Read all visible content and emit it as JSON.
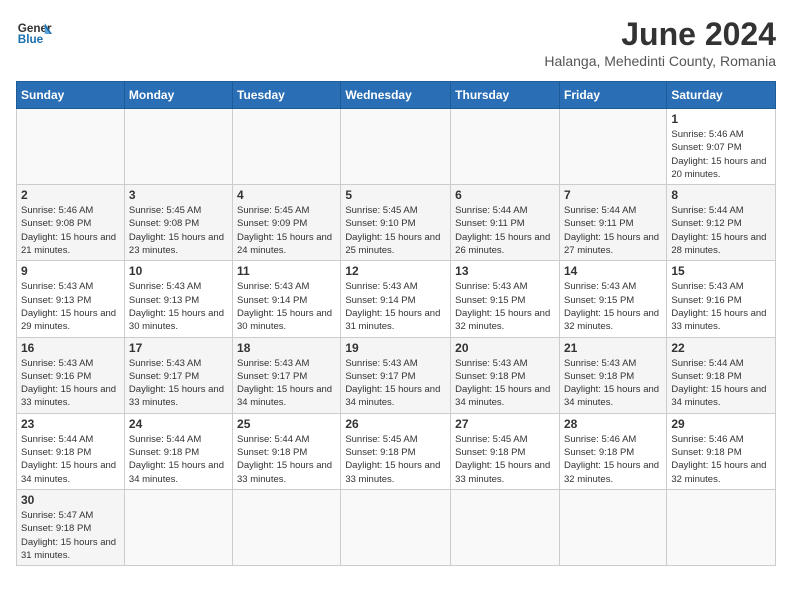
{
  "header": {
    "logo_general": "General",
    "logo_blue": "Blue",
    "month_title": "June 2024",
    "subtitle": "Halanga, Mehedinti County, Romania"
  },
  "weekdays": [
    "Sunday",
    "Monday",
    "Tuesday",
    "Wednesday",
    "Thursday",
    "Friday",
    "Saturday"
  ],
  "weeks": [
    [
      {
        "day": "",
        "info": ""
      },
      {
        "day": "",
        "info": ""
      },
      {
        "day": "",
        "info": ""
      },
      {
        "day": "",
        "info": ""
      },
      {
        "day": "",
        "info": ""
      },
      {
        "day": "",
        "info": ""
      },
      {
        "day": "1",
        "info": "Sunrise: 5:46 AM\nSunset: 9:07 PM\nDaylight: 15 hours\nand 20 minutes."
      }
    ],
    [
      {
        "day": "2",
        "info": "Sunrise: 5:46 AM\nSunset: 9:08 PM\nDaylight: 15 hours\nand 21 minutes."
      },
      {
        "day": "3",
        "info": "Sunrise: 5:45 AM\nSunset: 9:08 PM\nDaylight: 15 hours\nand 23 minutes."
      },
      {
        "day": "4",
        "info": "Sunrise: 5:45 AM\nSunset: 9:09 PM\nDaylight: 15 hours\nand 24 minutes."
      },
      {
        "day": "5",
        "info": "Sunrise: 5:45 AM\nSunset: 9:10 PM\nDaylight: 15 hours\nand 25 minutes."
      },
      {
        "day": "6",
        "info": "Sunrise: 5:44 AM\nSunset: 9:11 PM\nDaylight: 15 hours\nand 26 minutes."
      },
      {
        "day": "7",
        "info": "Sunrise: 5:44 AM\nSunset: 9:11 PM\nDaylight: 15 hours\nand 27 minutes."
      },
      {
        "day": "8",
        "info": "Sunrise: 5:44 AM\nSunset: 9:12 PM\nDaylight: 15 hours\nand 28 minutes."
      }
    ],
    [
      {
        "day": "9",
        "info": "Sunrise: 5:43 AM\nSunset: 9:13 PM\nDaylight: 15 hours\nand 29 minutes."
      },
      {
        "day": "10",
        "info": "Sunrise: 5:43 AM\nSunset: 9:13 PM\nDaylight: 15 hours\nand 30 minutes."
      },
      {
        "day": "11",
        "info": "Sunrise: 5:43 AM\nSunset: 9:14 PM\nDaylight: 15 hours\nand 30 minutes."
      },
      {
        "day": "12",
        "info": "Sunrise: 5:43 AM\nSunset: 9:14 PM\nDaylight: 15 hours\nand 31 minutes."
      },
      {
        "day": "13",
        "info": "Sunrise: 5:43 AM\nSunset: 9:15 PM\nDaylight: 15 hours\nand 32 minutes."
      },
      {
        "day": "14",
        "info": "Sunrise: 5:43 AM\nSunset: 9:15 PM\nDaylight: 15 hours\nand 32 minutes."
      },
      {
        "day": "15",
        "info": "Sunrise: 5:43 AM\nSunset: 9:16 PM\nDaylight: 15 hours\nand 33 minutes."
      }
    ],
    [
      {
        "day": "16",
        "info": "Sunrise: 5:43 AM\nSunset: 9:16 PM\nDaylight: 15 hours\nand 33 minutes."
      },
      {
        "day": "17",
        "info": "Sunrise: 5:43 AM\nSunset: 9:17 PM\nDaylight: 15 hours\nand 33 minutes."
      },
      {
        "day": "18",
        "info": "Sunrise: 5:43 AM\nSunset: 9:17 PM\nDaylight: 15 hours\nand 34 minutes."
      },
      {
        "day": "19",
        "info": "Sunrise: 5:43 AM\nSunset: 9:17 PM\nDaylight: 15 hours\nand 34 minutes."
      },
      {
        "day": "20",
        "info": "Sunrise: 5:43 AM\nSunset: 9:18 PM\nDaylight: 15 hours\nand 34 minutes."
      },
      {
        "day": "21",
        "info": "Sunrise: 5:43 AM\nSunset: 9:18 PM\nDaylight: 15 hours\nand 34 minutes."
      },
      {
        "day": "22",
        "info": "Sunrise: 5:44 AM\nSunset: 9:18 PM\nDaylight: 15 hours\nand 34 minutes."
      }
    ],
    [
      {
        "day": "23",
        "info": "Sunrise: 5:44 AM\nSunset: 9:18 PM\nDaylight: 15 hours\nand 34 minutes."
      },
      {
        "day": "24",
        "info": "Sunrise: 5:44 AM\nSunset: 9:18 PM\nDaylight: 15 hours\nand 34 minutes."
      },
      {
        "day": "25",
        "info": "Sunrise: 5:44 AM\nSunset: 9:18 PM\nDaylight: 15 hours\nand 33 minutes."
      },
      {
        "day": "26",
        "info": "Sunrise: 5:45 AM\nSunset: 9:18 PM\nDaylight: 15 hours\nand 33 minutes."
      },
      {
        "day": "27",
        "info": "Sunrise: 5:45 AM\nSunset: 9:18 PM\nDaylight: 15 hours\nand 33 minutes."
      },
      {
        "day": "28",
        "info": "Sunrise: 5:46 AM\nSunset: 9:18 PM\nDaylight: 15 hours\nand 32 minutes."
      },
      {
        "day": "29",
        "info": "Sunrise: 5:46 AM\nSunset: 9:18 PM\nDaylight: 15 hours\nand 32 minutes."
      }
    ],
    [
      {
        "day": "30",
        "info": "Sunrise: 5:47 AM\nSunset: 9:18 PM\nDaylight: 15 hours\nand 31 minutes."
      },
      {
        "day": "",
        "info": ""
      },
      {
        "day": "",
        "info": ""
      },
      {
        "day": "",
        "info": ""
      },
      {
        "day": "",
        "info": ""
      },
      {
        "day": "",
        "info": ""
      },
      {
        "day": "",
        "info": ""
      }
    ]
  ]
}
